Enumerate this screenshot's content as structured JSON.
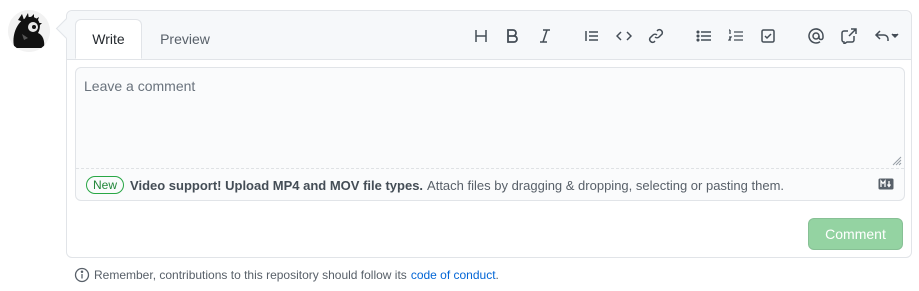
{
  "tabs": {
    "write": "Write",
    "preview": "Preview"
  },
  "toolbar": {
    "icons": [
      "heading-icon",
      "bold-icon",
      "italic-icon",
      "quote-icon",
      "code-icon",
      "link-icon",
      "bulleted-list-icon",
      "numbered-list-icon",
      "task-list-icon",
      "mention-icon",
      "cross-reference-icon",
      "reply-icon"
    ]
  },
  "editor": {
    "placeholder": "Leave a comment"
  },
  "file_bar": {
    "badge": "New",
    "highlight": "Video support! Upload MP4 and MOV file types.",
    "text": "Attach files by dragging & dropping, selecting or pasting them."
  },
  "actions": {
    "comment": "Comment"
  },
  "footer": {
    "text": "Remember, contributions to this repository should follow its",
    "link": "code of conduct",
    "period": "."
  },
  "colors": {
    "accent_green": "#94d3a2",
    "link": "#0366d6"
  }
}
